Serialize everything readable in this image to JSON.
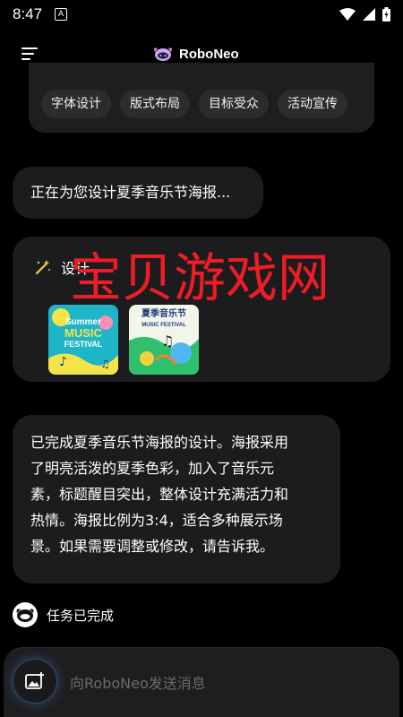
{
  "status_bar": {
    "time": "8:47",
    "notification_glyph": "A"
  },
  "app": {
    "name": "RoboNeo"
  },
  "chips": [
    "字体设计",
    "版式布局",
    "目标受众",
    "活动宣传"
  ],
  "messages": {
    "status_text": "正在为您设计夏季音乐节海报...",
    "design_label": "设计",
    "poster1": {
      "line1": "Summer",
      "line2": "MUSIC",
      "line3": "FESTIVAL"
    },
    "poster2": {
      "line1": "夏季音乐节",
      "line2": "MUSIC FESTIVAL"
    },
    "result_lines": [
      "已完成夏季音乐节海报的设计。海报采用",
      "了明亮活泼的夏季色彩，加入了音乐元",
      "素，标题醒目突出，整体设计充满活力和",
      "热情。海报比例为3:4，适合多种展示场",
      "景。如果需要调整或修改，请告诉我。"
    ],
    "task_status": "任务已完成"
  },
  "input": {
    "placeholder": "向RoboNeo发送消息"
  },
  "watermark": "宝贝游戏网",
  "icons": {
    "menu": "menu-icon",
    "logo": "roboneo-logo-icon",
    "wand": "magic-wand-icon",
    "image": "image-icon",
    "avatar": "roboneo-avatar-icon",
    "wifi": "wifi-icon",
    "signal": "signal-icon",
    "battery": "battery-icon"
  },
  "colors": {
    "background": "#000000",
    "bubble": "#1c1c1e",
    "watermark": "#ee1c25",
    "wand": "#f2d23a"
  }
}
